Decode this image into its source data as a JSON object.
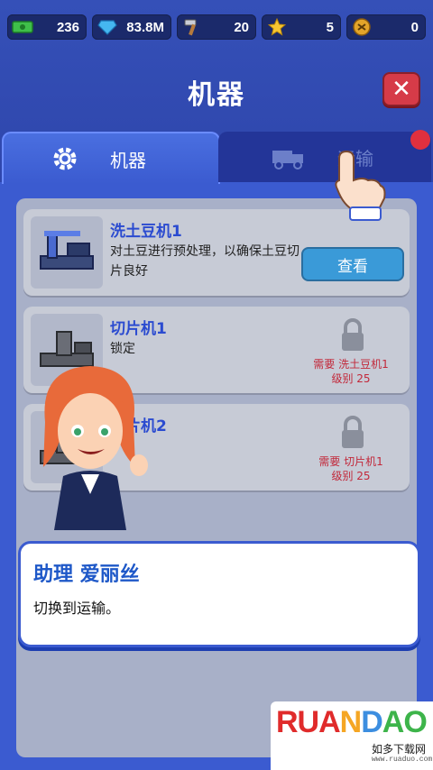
{
  "resources": [
    {
      "icon": "cash-icon",
      "value": "236"
    },
    {
      "icon": "diamond-icon",
      "value": "83.8M"
    },
    {
      "icon": "hammer-icon",
      "value": "20"
    },
    {
      "icon": "star-icon",
      "value": "5"
    },
    {
      "icon": "token-icon",
      "value": "0"
    }
  ],
  "header": {
    "title": "机器"
  },
  "tabs": [
    {
      "label": "机器",
      "icon": "gear-icon",
      "active": true
    },
    {
      "label": "运输",
      "icon": "truck-icon",
      "active": false
    }
  ],
  "machines": [
    {
      "name": "洗土豆机1",
      "description": "对土豆进行预处理，以确保土豆切片良好",
      "button": "查看",
      "locked": false
    },
    {
      "name": "切片机1",
      "description": "锁定",
      "locked": true,
      "requirement": "需要 洗土豆机1",
      "level": "级别 25"
    },
    {
      "name": "切片机2",
      "description": "",
      "locked": true,
      "requirement": "需要 切片机1",
      "level": "级别 25"
    }
  ],
  "dialog": {
    "speaker": "助理 爱丽丝",
    "message": "切换到运输。"
  },
  "watermark": {
    "logo": "RUANDAO",
    "sub": "如多下载网",
    "url": "www.ruaduo.com"
  },
  "colors": {
    "accent": "#3b5bd0",
    "close": "#d63b48",
    "view_button": "#3a9ad8",
    "locked_text": "#c2283a",
    "notify": "#e0303e"
  }
}
